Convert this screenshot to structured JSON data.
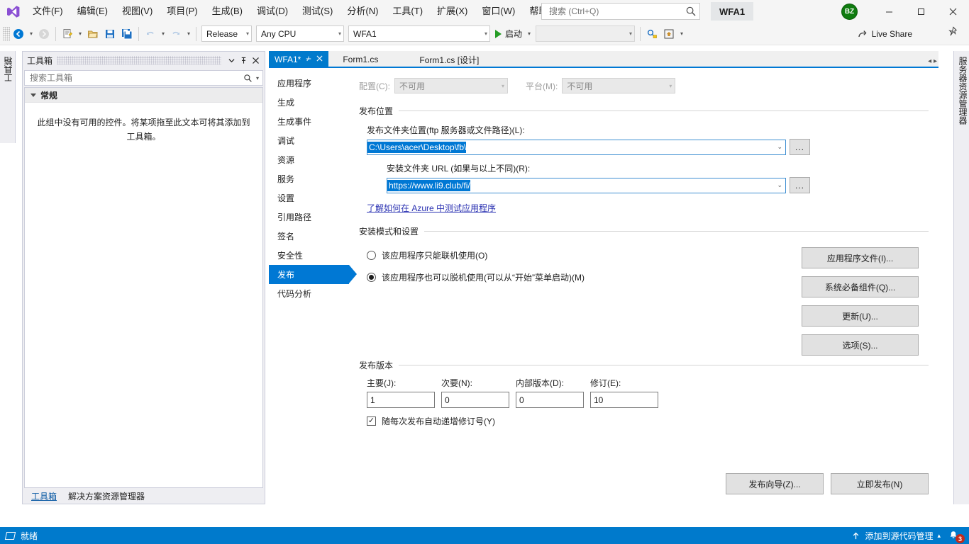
{
  "window": {
    "app_title": "WFA1",
    "minimize_icon": "minimize-icon",
    "maximize_icon": "maximize-icon",
    "close_icon": "close-icon",
    "avatar_initials": "BZ"
  },
  "menu": {
    "items": [
      {
        "label": "文件(F)"
      },
      {
        "label": "编辑(E)"
      },
      {
        "label": "视图(V)"
      },
      {
        "label": "项目(P)"
      },
      {
        "label": "生成(B)"
      },
      {
        "label": "调试(D)"
      },
      {
        "label": "测试(S)"
      },
      {
        "label": "分析(N)"
      },
      {
        "label": "工具(T)"
      },
      {
        "label": "扩展(X)"
      },
      {
        "label": "窗口(W)"
      },
      {
        "label": "帮助(H)"
      }
    ]
  },
  "search": {
    "placeholder": "搜索 (Ctrl+Q)",
    "icon": "search-icon"
  },
  "toolbar": {
    "configuration": "Release",
    "platform": "Any CPU",
    "startup_project": "WFA1",
    "run_label": "启动",
    "attach_target_placeholder": "",
    "live_share_label": "Live Share",
    "live_share_icon": "live-share-icon",
    "pin_icon": "pin-icon"
  },
  "dock": {
    "left_vertical_tab": "工具箱",
    "right_vertical_tab": "服务器资源管理器"
  },
  "toolbox": {
    "title": "工具箱",
    "search_placeholder": "搜索工具箱",
    "group_label": "常规",
    "empty_message": "此组中没有可用的控件。将某项拖至此文本可将其添加到工具箱。",
    "footer_tabs": [
      {
        "label": "工具箱",
        "active": true
      },
      {
        "label": "解决方案资源管理器",
        "active": false
      }
    ],
    "dropdown_icon": "chevron-down-icon",
    "pin_icon": "pin-icon",
    "close_icon": "close-icon"
  },
  "tabs": [
    {
      "label": "WFA1*",
      "active": true,
      "pin_icon": "pin-icon",
      "close_icon": "close-icon"
    },
    {
      "label": "Form1.cs",
      "active": false
    },
    {
      "label": "Form1.cs [设计]",
      "active": false
    }
  ],
  "property_nav": {
    "items": [
      {
        "label": "应用程序",
        "active": false
      },
      {
        "label": "生成",
        "active": false
      },
      {
        "label": "生成事件",
        "active": false
      },
      {
        "label": "调试",
        "active": false
      },
      {
        "label": "资源",
        "active": false
      },
      {
        "label": "服务",
        "active": false
      },
      {
        "label": "设置",
        "active": false
      },
      {
        "label": "引用路径",
        "active": false
      },
      {
        "label": "签名",
        "active": false
      },
      {
        "label": "安全性",
        "active": false
      },
      {
        "label": "发布",
        "active": true
      },
      {
        "label": "代码分析",
        "active": false
      }
    ]
  },
  "publish": {
    "configuration_label": "配置(C):",
    "configuration_value": "不可用",
    "platform_label": "平台(M):",
    "platform_value": "不可用",
    "location_section_title": "发布位置",
    "folder_label": "发布文件夹位置(ftp 服务器或文件路径)(L):",
    "folder_value": "C:\\Users\\acer\\Desktop\\fb\\",
    "install_url_label": "安装文件夹 URL (如果与以上不同)(R):",
    "install_url_value": "https://www.li9.club/fi/",
    "browse_button": "...",
    "azure_link": "了解如何在 Azure 中测试应用程序",
    "install_section_title": "安装模式和设置",
    "radio_online_label": "该应用程序只能联机使用(O)",
    "radio_online_selected": false,
    "radio_offline_label": "该应用程序也可以脱机使用(可以从“开始”菜单启动)(M)",
    "radio_offline_selected": true,
    "side_buttons": [
      {
        "label": "应用程序文件(I)..."
      },
      {
        "label": "系统必备组件(Q)..."
      },
      {
        "label": "更新(U)..."
      },
      {
        "label": "选项(S)..."
      }
    ],
    "version_section_title": "发布版本",
    "version_fields": [
      {
        "label": "主要(J):",
        "value": "1"
      },
      {
        "label": "次要(N):",
        "value": "0"
      },
      {
        "label": "内部版本(D):",
        "value": "0"
      },
      {
        "label": "修订(E):",
        "value": "10"
      }
    ],
    "auto_increment_label": "随每次发布自动递增修订号(Y)",
    "auto_increment_checked": true,
    "wizard_button": "发布向导(Z)...",
    "publish_now_button": "立即发布(N)"
  },
  "statusbar": {
    "ready_label": "就绪",
    "source_control_label": "添加到源代码管理",
    "notification_count": "3",
    "flag_icon": "flag-icon",
    "upload-icon": "upload-icon",
    "chevron_icon": "chevron-up-icon",
    "bell_icon": "bell-icon"
  },
  "colors": {
    "accent": "#007acc",
    "selection": "#0078d4",
    "statusbar": "#007acc",
    "link": "#2b32b2",
    "avatar": "#107c10",
    "badge": "#c42b1c"
  }
}
